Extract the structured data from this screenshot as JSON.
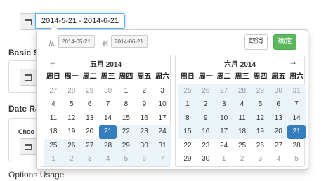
{
  "page": {
    "sections": [
      {
        "label": "Basic S"
      },
      {
        "label": "Date Ra"
      },
      {
        "label": "Choo"
      },
      {
        "label": "Options Usage"
      }
    ]
  },
  "input": {
    "value": "2014-5-21 - 2014-6-21"
  },
  "picker": {
    "from_label": "从",
    "from_value": "2014-05-21",
    "to_label": "到",
    "to_value": "2014-06-21",
    "cancel_label": "取消",
    "ok_label": "确定",
    "weekdays": [
      "周日",
      "周一",
      "周二",
      "周三",
      "周四",
      "周五",
      "周六"
    ],
    "calendars": [
      {
        "title": "五月 2014",
        "prev": "←",
        "next": "→",
        "weeks": [
          [
            {
              "d": "27",
              "s": "other"
            },
            {
              "d": "28",
              "s": "other"
            },
            {
              "d": "29",
              "s": "other"
            },
            {
              "d": "30",
              "s": "other"
            },
            {
              "d": "1",
              "s": ""
            },
            {
              "d": "2",
              "s": ""
            },
            {
              "d": "3",
              "s": ""
            }
          ],
          [
            {
              "d": "4",
              "s": ""
            },
            {
              "d": "5",
              "s": ""
            },
            {
              "d": "6",
              "s": ""
            },
            {
              "d": "7",
              "s": ""
            },
            {
              "d": "8",
              "s": ""
            },
            {
              "d": "9",
              "s": ""
            },
            {
              "d": "10",
              "s": ""
            }
          ],
          [
            {
              "d": "11",
              "s": ""
            },
            {
              "d": "12",
              "s": ""
            },
            {
              "d": "13",
              "s": ""
            },
            {
              "d": "14",
              "s": ""
            },
            {
              "d": "15",
              "s": ""
            },
            {
              "d": "16",
              "s": ""
            },
            {
              "d": "17",
              "s": ""
            }
          ],
          [
            {
              "d": "18",
              "s": ""
            },
            {
              "d": "19",
              "s": ""
            },
            {
              "d": "20",
              "s": ""
            },
            {
              "d": "21",
              "s": "selected"
            },
            {
              "d": "22",
              "s": "inrange"
            },
            {
              "d": "23",
              "s": "inrange"
            },
            {
              "d": "24",
              "s": "inrange"
            }
          ],
          [
            {
              "d": "25",
              "s": "inrange"
            },
            {
              "d": "26",
              "s": "inrange"
            },
            {
              "d": "27",
              "s": "inrange"
            },
            {
              "d": "28",
              "s": "inrange"
            },
            {
              "d": "29",
              "s": "inrange"
            },
            {
              "d": "30",
              "s": "inrange"
            },
            {
              "d": "31",
              "s": "inrange"
            }
          ],
          [
            {
              "d": "1",
              "s": "other inrange"
            },
            {
              "d": "2",
              "s": "other inrange"
            },
            {
              "d": "3",
              "s": "other inrange"
            },
            {
              "d": "4",
              "s": "other inrange"
            },
            {
              "d": "5",
              "s": "other inrange"
            },
            {
              "d": "6",
              "s": "other inrange"
            },
            {
              "d": "7",
              "s": "other inrange"
            }
          ]
        ]
      },
      {
        "title": "六月 2014",
        "prev": "←",
        "next": "→",
        "weeks": [
          [
            {
              "d": "25",
              "s": "other inrange"
            },
            {
              "d": "26",
              "s": "other inrange"
            },
            {
              "d": "27",
              "s": "other inrange"
            },
            {
              "d": "28",
              "s": "other inrange"
            },
            {
              "d": "29",
              "s": "other inrange"
            },
            {
              "d": "30",
              "s": "other inrange"
            },
            {
              "d": "31",
              "s": "other inrange"
            }
          ],
          [
            {
              "d": "1",
              "s": "inrange"
            },
            {
              "d": "2",
              "s": "inrange"
            },
            {
              "d": "3",
              "s": "inrange"
            },
            {
              "d": "4",
              "s": "inrange"
            },
            {
              "d": "5",
              "s": "inrange"
            },
            {
              "d": "6",
              "s": "inrange"
            },
            {
              "d": "7",
              "s": "inrange"
            }
          ],
          [
            {
              "d": "8",
              "s": "inrange"
            },
            {
              "d": "9",
              "s": "inrange"
            },
            {
              "d": "10",
              "s": "inrange"
            },
            {
              "d": "11",
              "s": "inrange"
            },
            {
              "d": "12",
              "s": "inrange"
            },
            {
              "d": "13",
              "s": "inrange"
            },
            {
              "d": "14",
              "s": "inrange"
            }
          ],
          [
            {
              "d": "15",
              "s": "inrange"
            },
            {
              "d": "16",
              "s": "inrange"
            },
            {
              "d": "17",
              "s": "inrange"
            },
            {
              "d": "18",
              "s": "inrange"
            },
            {
              "d": "19",
              "s": "inrange"
            },
            {
              "d": "20",
              "s": "inrange"
            },
            {
              "d": "21",
              "s": "selected"
            }
          ],
          [
            {
              "d": "22",
              "s": ""
            },
            {
              "d": "23",
              "s": ""
            },
            {
              "d": "24",
              "s": ""
            },
            {
              "d": "25",
              "s": ""
            },
            {
              "d": "26",
              "s": ""
            },
            {
              "d": "27",
              "s": ""
            },
            {
              "d": "28",
              "s": ""
            }
          ],
          [
            {
              "d": "29",
              "s": ""
            },
            {
              "d": "30",
              "s": ""
            },
            {
              "d": "1",
              "s": "other"
            },
            {
              "d": "2",
              "s": "other"
            },
            {
              "d": "3",
              "s": "other"
            },
            {
              "d": "4",
              "s": "other"
            },
            {
              "d": "5",
              "s": "other"
            }
          ]
        ]
      }
    ]
  },
  "colors": {
    "selected": "#357ebd",
    "in_range": "#ebf4f8",
    "ok_button": "#5cb85c",
    "focus": "#66afe9"
  }
}
